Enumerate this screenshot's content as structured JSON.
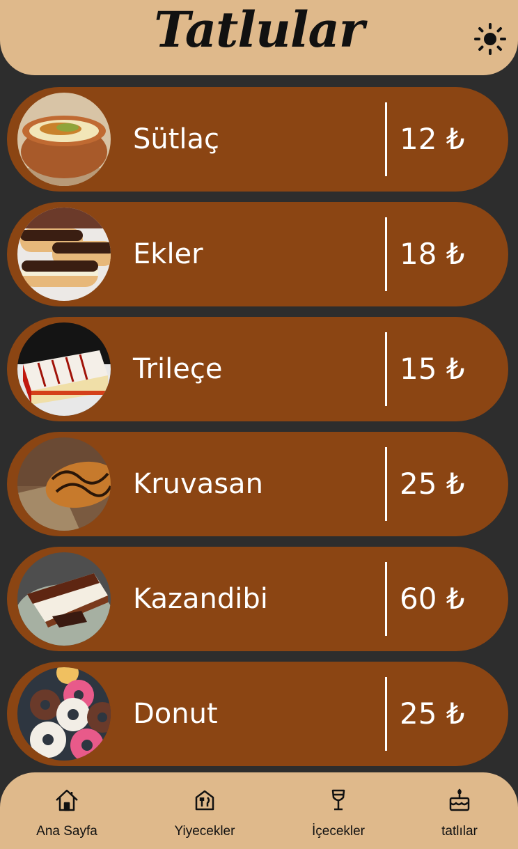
{
  "header": {
    "title": "Tatlular",
    "theme_icon": "sun-icon"
  },
  "menu": {
    "items": [
      {
        "name": "Sütlaç",
        "price": "12 ₺",
        "image": "sutlac-photo"
      },
      {
        "name": "Ekler",
        "price": "18 ₺",
        "image": "ekler-photo"
      },
      {
        "name": "Trileçe",
        "price": "15 ₺",
        "image": "trilece-photo"
      },
      {
        "name": "Kruvasan",
        "price": "25 ₺",
        "image": "kruvasan-photo"
      },
      {
        "name": "Kazandibi",
        "price": "60 ₺",
        "image": "kazandibi-photo"
      },
      {
        "name": "Donut",
        "price": "25 ₺",
        "image": "donut-photo"
      }
    ]
  },
  "nav": {
    "items": [
      {
        "label": "Ana Sayfa",
        "icon": "home-icon"
      },
      {
        "label": "Yiyecekler",
        "icon": "restaurant-icon"
      },
      {
        "label": "İçecekler",
        "icon": "wine-glass-icon"
      },
      {
        "label": "tatlılar",
        "icon": "cake-icon"
      }
    ]
  },
  "colors": {
    "background": "#2d2d2d",
    "header": "#dfb98b",
    "item_background": "#8b4513",
    "item_text": "#ffffff"
  }
}
